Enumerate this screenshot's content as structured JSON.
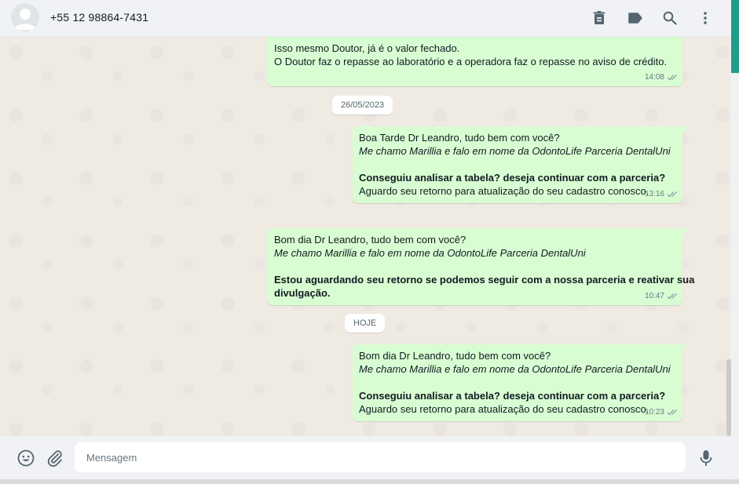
{
  "header": {
    "contact_name": "+55 12 98864-7431",
    "icons": [
      "delete-icon",
      "label-icon",
      "search-icon",
      "menu-icon"
    ]
  },
  "messages": [
    {
      "lines": [
        {
          "text": "Isso mesmo Doutor, já é o valor fechado.",
          "style": "normal"
        },
        {
          "text": "O Doutor faz o repasse ao laboratório e a operadora faz o repasse no aviso de crédito.",
          "style": "normal"
        }
      ],
      "time": "14:08"
    },
    {
      "lines": [
        {
          "text": "Boa Tarde Dr Leandro, tudo bem com você?",
          "style": "normal"
        },
        {
          "text": "Me chamo Marillia e falo em nome da OdontoLife Parceria DentalUni",
          "style": "italic"
        },
        {
          "text": "Conseguiu analisar a tabela? deseja continuar com a parceria?",
          "style": "bold"
        },
        {
          "text": "Aguardo seu retorno para atualização do seu cadastro conosco.",
          "style": "normal"
        }
      ],
      "time": "13:16"
    },
    {
      "lines": [
        {
          "text": "Bom dia Dr Leandro, tudo bem com você?",
          "style": "normal"
        },
        {
          "text": "Me chamo Marillia e falo em nome da OdontoLife Parceria DentalUni",
          "style": "italic"
        },
        {
          "text": "Estou aguardando seu retorno se podemos seguir com a nossa parceria e reativar sua",
          "style": "bold"
        },
        {
          "text": "divulgação.",
          "style": "bold"
        }
      ],
      "time": "10:47"
    },
    {
      "lines": [
        {
          "text": "Bom dia Dr Leandro, tudo bem com você?",
          "style": "normal"
        },
        {
          "text": "Me chamo Marillia e falo em nome da OdontoLife Parceria DentalUni",
          "style": "italic"
        },
        {
          "text": "Conseguiu analisar a tabela? deseja continuar com a parceria?",
          "style": "bold"
        },
        {
          "text": "Aguardo seu retorno para atualização do seu cadastro conosco.",
          "style": "normal"
        }
      ],
      "time": "10:23"
    }
  ],
  "date_chips": [
    "26/05/2023",
    "HOJE"
  ],
  "composer": {
    "placeholder": "Mensagem",
    "value": ""
  },
  "colors": {
    "bubble_out": "#d9fdd3",
    "chat_bg": "#efeae2",
    "header_bg": "#f0f2f5",
    "accent": "#1f9c8a"
  }
}
